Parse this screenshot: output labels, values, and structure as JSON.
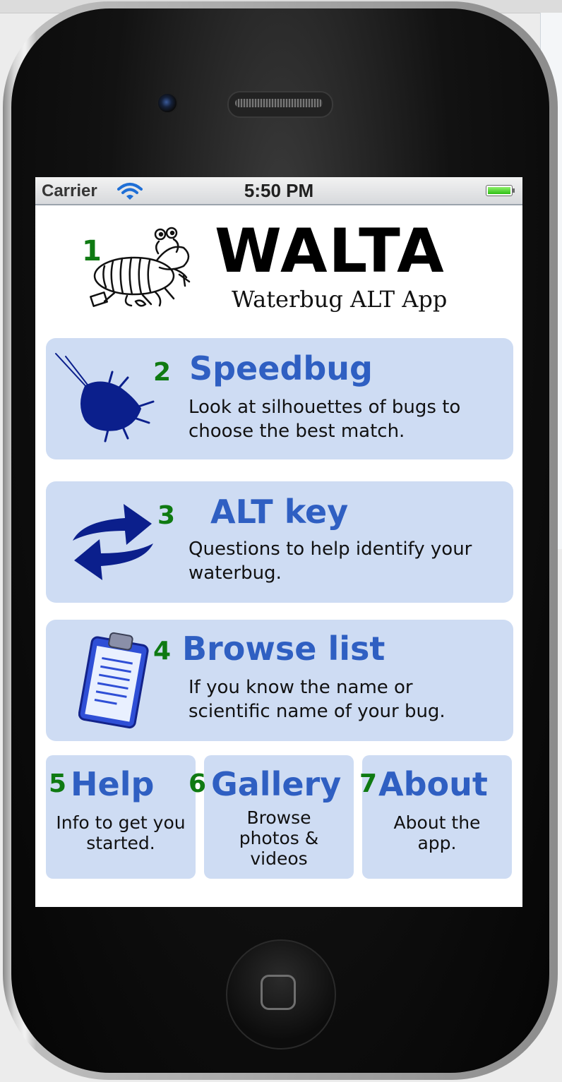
{
  "status_bar": {
    "carrier": "Carrier",
    "time": "5:50 PM",
    "wifi_icon": "wifi-icon",
    "battery_icon": "battery-icon",
    "battery_level": 1.0
  },
  "header": {
    "number": "1",
    "title": "WALTA",
    "subtitle": "Waterbug ALT App",
    "logo_icon": "waterbug-drawing-icon"
  },
  "menu": {
    "speedbug": {
      "number": "2",
      "title": "Speedbug",
      "description": "Look at silhouettes of bugs to choose the best match.",
      "icon": "bug-silhouette-icon"
    },
    "alt_key": {
      "number": "3",
      "title": "ALT key",
      "description": "Questions to help identify your waterbug.",
      "icon": "swap-arrows-icon"
    },
    "browse_list": {
      "number": "4",
      "title": "Browse list",
      "description": "If you know the name or scientific name of your bug.",
      "icon": "clipboard-icon"
    },
    "help": {
      "number": "5",
      "title": "Help",
      "description": "Info to get you started."
    },
    "gallery": {
      "number": "6",
      "title": "Gallery",
      "description": "Browse photos & videos"
    },
    "about": {
      "number": "7",
      "title": "About",
      "description": "About the app."
    }
  },
  "colors": {
    "card_background": "#cedcf3",
    "title_blue": "#2f5fc2",
    "number_green": "#0f7a12",
    "icon_navy": "#0b1f8c"
  }
}
